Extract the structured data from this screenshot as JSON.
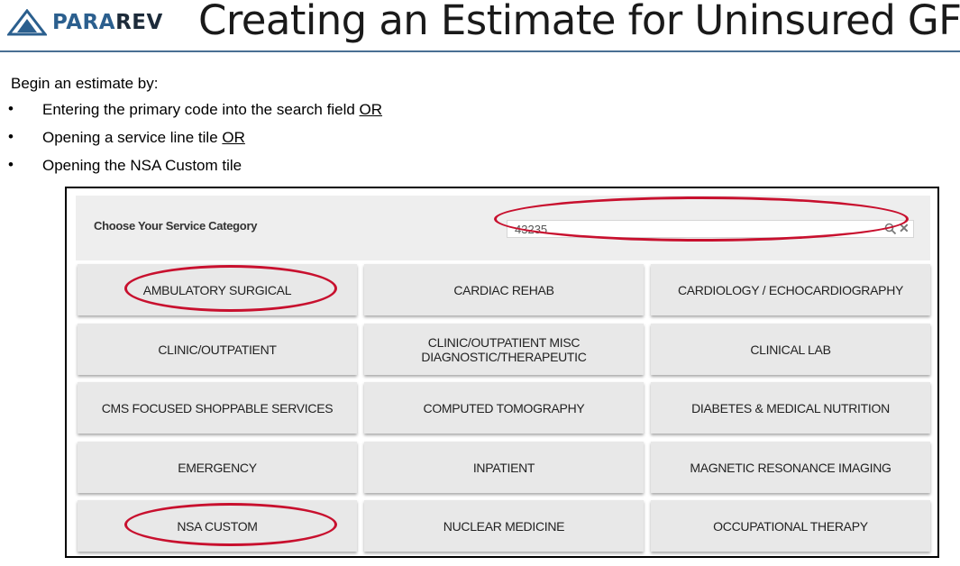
{
  "slide": {
    "logo_part1": "PARA",
    "logo_part2": "REV",
    "title": "Creating an Estimate for Uninsured GFE",
    "intro": "Begin an estimate by:",
    "bullets": [
      {
        "text": "Entering the primary code into the search field ",
        "or": "OR"
      },
      {
        "text": "Opening a service line tile ",
        "or": "OR"
      },
      {
        "text": "Opening the NSA Custom tile",
        "or": ""
      }
    ]
  },
  "app": {
    "category_label": "Choose Your Service Category",
    "search": {
      "value": "43235",
      "placeholder": ""
    },
    "tiles": [
      "AMBULATORY SURGICAL",
      "CARDIAC REHAB",
      "CARDIOLOGY / ECHOCARDIOGRAPHY",
      "CLINIC/OUTPATIENT",
      "CLINIC/OUTPATIENT MISC DIAGNOSTIC/THERAPEUTIC",
      "CLINICAL LAB",
      "CMS FOCUSED SHOPPABLE SERVICES",
      "COMPUTED TOMOGRAPHY",
      "DIABETES & MEDICAL NUTRITION",
      "EMERGENCY",
      "INPATIENT",
      "MAGNETIC RESONANCE IMAGING",
      "NSA CUSTOM",
      "NUCLEAR MEDICINE",
      "OCCUPATIONAL THERAPY"
    ]
  },
  "colors": {
    "annotation": "#c8102e",
    "brand_blue": "#2b5f8e",
    "rule": "#4a6f93",
    "tile_bg": "#e8e8e8"
  },
  "icons": {
    "logo": "pararev-logo-icon",
    "search": "search-icon",
    "clear": "clear-icon"
  }
}
